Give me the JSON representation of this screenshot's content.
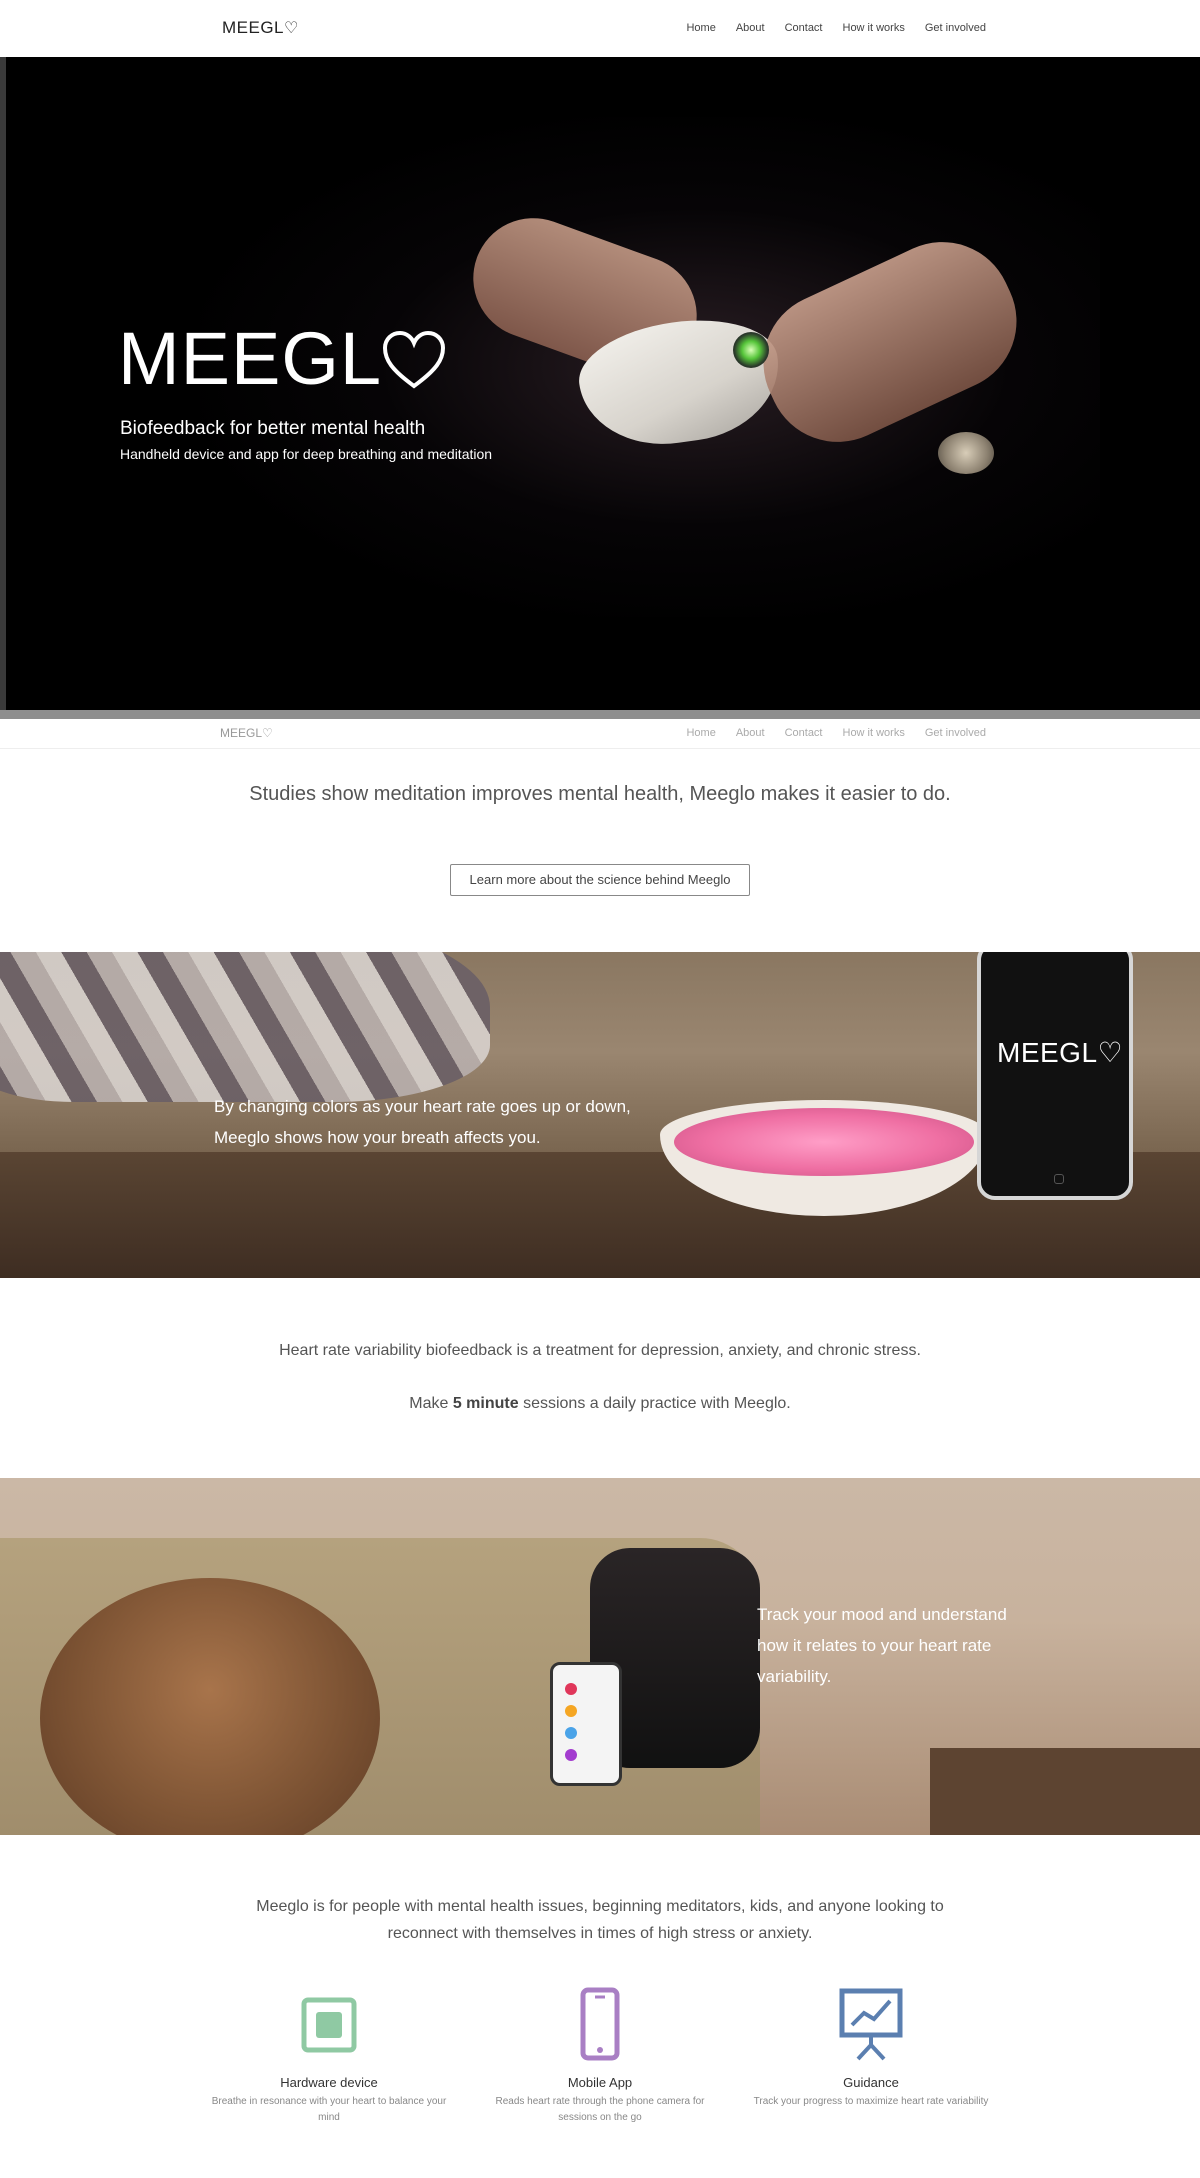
{
  "nav": {
    "logo": "MEEGL",
    "links": [
      "Home",
      "About",
      "Contact",
      "How it works",
      "Get involved"
    ]
  },
  "hero": {
    "title": "MEEGL",
    "tagline": "Biofeedback for better mental health",
    "subtagline": "Handheld device and app for deep breathing and meditation"
  },
  "subnav": {
    "logo": "MEEGL",
    "links": [
      "Home",
      "About",
      "Contact",
      "How it works",
      "Get involved"
    ]
  },
  "science": {
    "headline": "Studies show meditation improves mental health, Meeglo makes it easier to do.",
    "button_label": "Learn more about the science behind Meeglo"
  },
  "colors_band": {
    "text": "By changing colors as your heart rate goes up or down, Meeglo shows how your breath affects you.",
    "phone_logo": "MEEGL"
  },
  "hrv": {
    "line1": "Heart rate variability biofeedback is a treatment for depression, anxiety, and chronic stress.",
    "line2_pre": "Make ",
    "line2_bold": "5 minute",
    "line2_post": " sessions a daily practice with Meeglo."
  },
  "mood_band": {
    "text": "Track your mood and understand how it relates to your heart rate variability."
  },
  "audience": {
    "intro": "Meeglo is for people with mental health issues, beginning meditators, kids, and anyone looking to reconnect with themselves in times of high stress or anxiety."
  },
  "features": [
    {
      "title": "Hardware device",
      "desc": "Breathe in resonance with your heart to balance your mind",
      "icon": "device-icon",
      "color": "#8fc9a3"
    },
    {
      "title": "Mobile App",
      "desc": "Reads heart rate through the phone camera for sessions on the go",
      "icon": "mobile-phone-icon",
      "color": "#a97fc4"
    },
    {
      "title": "Guidance",
      "desc": "Track your progress to maximize heart rate variability",
      "icon": "presentation-chart-icon",
      "color": "#5b7fb0"
    }
  ]
}
